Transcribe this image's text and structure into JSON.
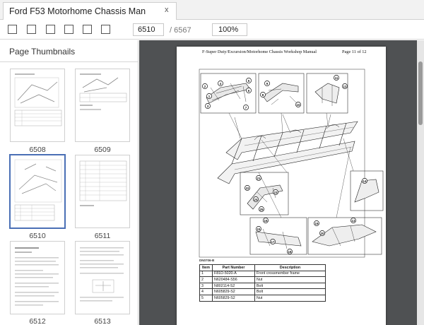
{
  "tab": {
    "title": "Ford F53 Motorhome Chassis Man",
    "close_glyph": "x"
  },
  "toolbar": {
    "page_current": "6510",
    "page_total": "/ 6567",
    "zoom": "100%"
  },
  "sidebar": {
    "title": "Page Thumbnails",
    "thumbnails": [
      {
        "label": "6508",
        "selected": false
      },
      {
        "label": "6509",
        "selected": false
      },
      {
        "label": "6510",
        "selected": true
      },
      {
        "label": "6511",
        "selected": false
      },
      {
        "label": "6512",
        "selected": false
      },
      {
        "label": "6513",
        "selected": false
      }
    ]
  },
  "page": {
    "header_title": "F-Super Duty/Excursion/Motorhome Chassis Workshop Manual",
    "header_page": "Page 11 of 12",
    "diagram_caption": "DN0706-B",
    "diagram_labels": [
      "1",
      "2",
      "3",
      "4",
      "5",
      "6",
      "7",
      "8",
      "9",
      "10",
      "11",
      "12",
      "13",
      "14",
      "15",
      "16",
      "17",
      "18",
      "19",
      "20",
      "21",
      "22",
      "23",
      "24",
      "25"
    ],
    "table": {
      "headers": [
        "Item",
        "Part Number",
        "Description"
      ],
      "rows": [
        [
          "1",
          "F81D-5020-A",
          "Front crossmember frame"
        ],
        [
          "2",
          "N620484-S56",
          "Nut"
        ],
        [
          "3",
          "N802114-S2",
          "Bolt"
        ],
        [
          "4",
          "N605829-S2",
          "Bolt"
        ],
        [
          "5",
          "N605829-S2",
          "Nut"
        ]
      ]
    }
  }
}
